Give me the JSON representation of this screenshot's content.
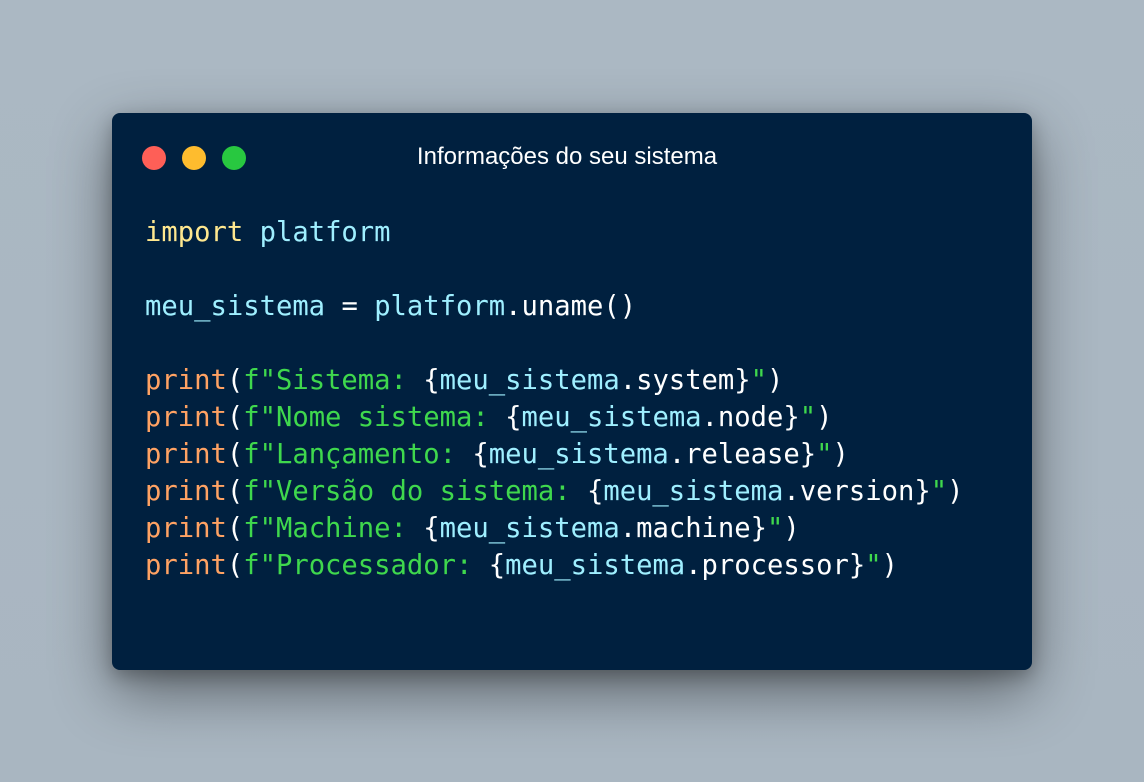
{
  "window": {
    "title": "Informações do seu sistema"
  },
  "code": {
    "line1": {
      "keyword": "import",
      "module": "platform"
    },
    "line2": {
      "var": "meu_sistema",
      "assign": "=",
      "obj": "platform",
      "method": ".uname",
      "parens": "()"
    },
    "prints": [
      {
        "fn": "print",
        "open": "(",
        "prefix": "f\"Sistema: ",
        "var": "meu_sistema",
        "attr": ".system",
        "close_quote": "\"",
        "close": ")"
      },
      {
        "fn": "print",
        "open": "(",
        "prefix": "f\"Nome sistema: ",
        "var": "meu_sistema",
        "attr": ".node",
        "close_quote": "\"",
        "close": ")"
      },
      {
        "fn": "print",
        "open": "(",
        "prefix": "f\"Lançamento: ",
        "var": "meu_sistema",
        "attr": ".release",
        "close_quote": "\"",
        "close": ")"
      },
      {
        "fn": "print",
        "open": "(",
        "prefix": "f\"Versão do sistema: ",
        "var": "meu_sistema",
        "attr": ".version",
        "close_quote": "\"",
        "close": ")"
      },
      {
        "fn": "print",
        "open": "(",
        "prefix": "f\"Machine: ",
        "var": "meu_sistema",
        "attr": ".machine",
        "close_quote": "\"",
        "close": ")"
      },
      {
        "fn": "print",
        "open": "(",
        "prefix": "f\"Processador: ",
        "var": "meu_sistema",
        "attr": ".processor",
        "close_quote": "\"",
        "close": ")"
      }
    ],
    "brace_open": "{",
    "brace_close": "}"
  },
  "colors": {
    "background": "#abb8c3",
    "window_bg": "#00203f",
    "close": "#fe5f57",
    "minimize": "#febc2e",
    "maximize": "#28c840",
    "keyword": "#ffe88f",
    "identifier": "#9fefff",
    "function": "#ffa263",
    "string": "#3fd84d",
    "plain": "#ffffff"
  }
}
